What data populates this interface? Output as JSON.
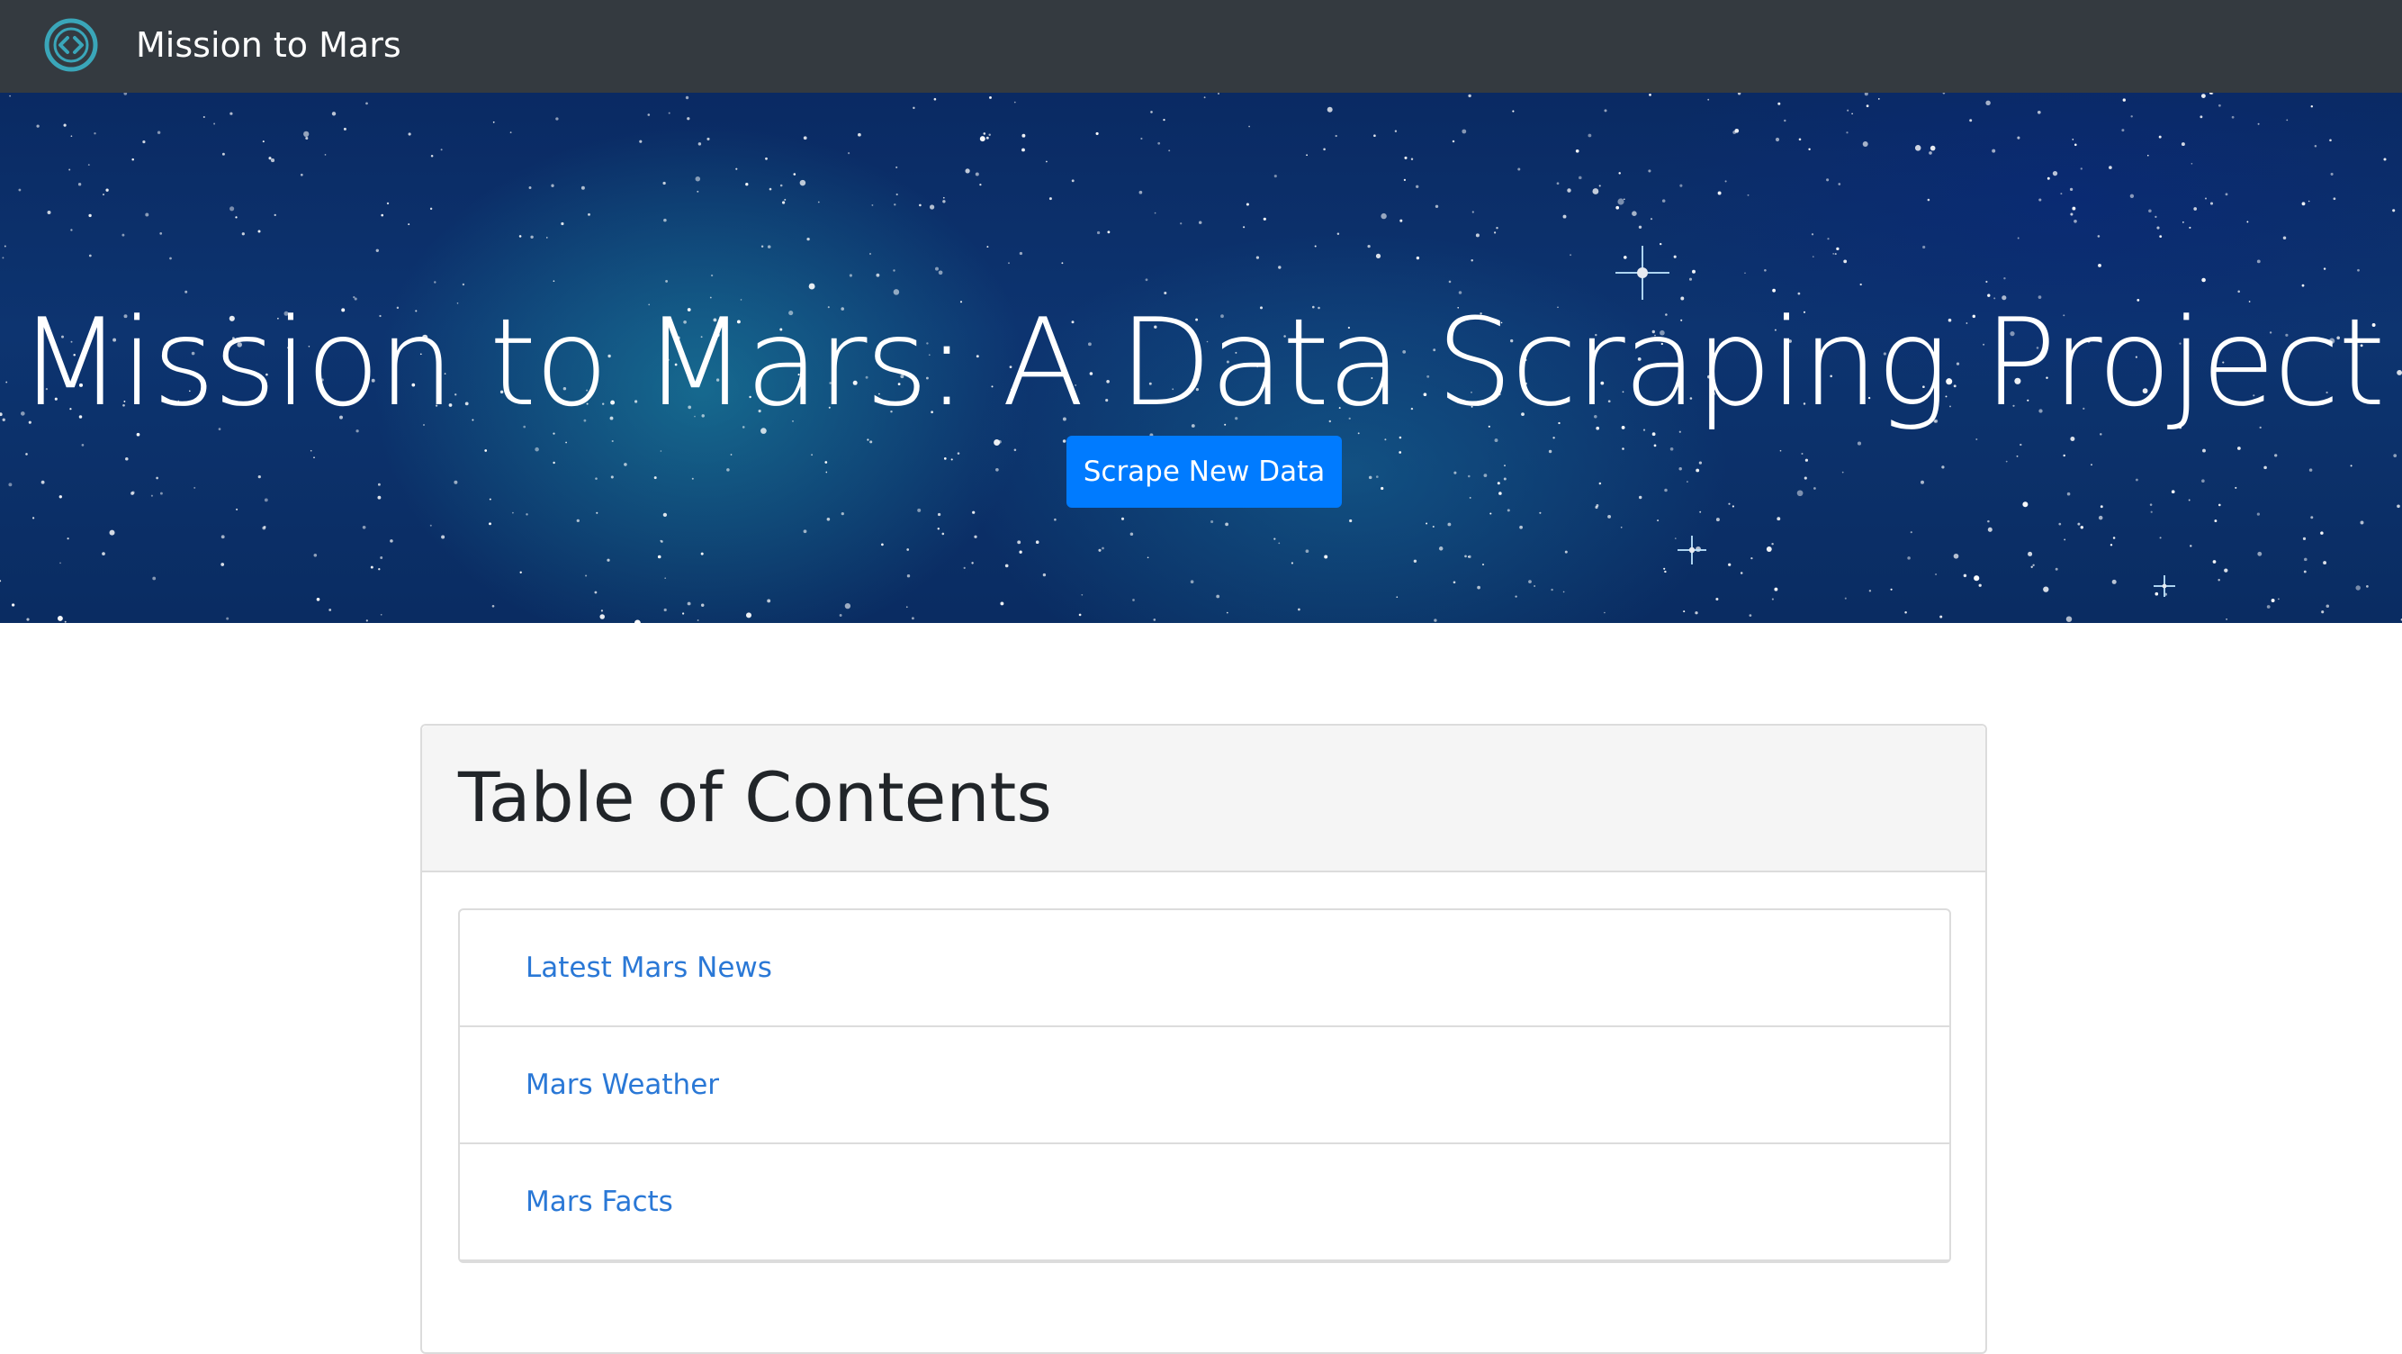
{
  "navbar": {
    "logo_icon": "code-circle-icon",
    "title": "Mission to Mars",
    "background": "#343a40"
  },
  "hero": {
    "title": "Mission to Mars: A Data Scraping Project",
    "button_label": "Scrape New Data",
    "button_color": "#007bff"
  },
  "toc": {
    "title": "Table of Contents",
    "items": [
      {
        "label": "Latest Mars News"
      },
      {
        "label": "Mars Weather"
      },
      {
        "label": "Mars Facts"
      }
    ],
    "link_color": "#2a78d6"
  }
}
